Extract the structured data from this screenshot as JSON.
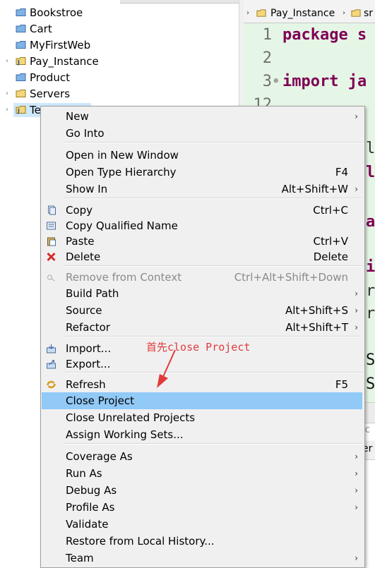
{
  "explorer": {
    "items": [
      {
        "label": "Bookstroe",
        "icon": "project-folder-icon",
        "expandable": false
      },
      {
        "label": "Cart",
        "icon": "project-folder-icon",
        "expandable": false
      },
      {
        "label": "MyFirstWeb",
        "icon": "project-folder-icon",
        "expandable": false
      },
      {
        "label": "Pay_Instance",
        "icon": "java-project-icon",
        "expandable": true
      },
      {
        "label": "Product",
        "icon": "project-folder-icon",
        "expandable": false
      },
      {
        "label": "Servers",
        "icon": "folder-icon",
        "expandable": true
      },
      {
        "label": "Te",
        "icon": "open-project-icon",
        "expandable": true,
        "selected": true
      }
    ],
    "arrow_glyph": "›"
  },
  "editor": {
    "tab_label": "Pay_Instance",
    "tab2_label": "sr",
    "lines": [
      {
        "num": "1",
        "text": "package s"
      },
      {
        "num": "2",
        "text": ""
      },
      {
        "num": "3",
        "text": "import ja"
      },
      {
        "num": "12",
        "text": ""
      }
    ],
    "fragments": [
      "l",
      "l",
      "a",
      "i",
      "r",
      "r",
      "S",
      "S",
      "c",
      "er"
    ]
  },
  "menu": {
    "items": [
      {
        "label": "New",
        "shortcut": "",
        "submenu": true
      },
      {
        "label": "Go Into",
        "shortcut": "",
        "submenu": false
      },
      {
        "label": "Open in New Window",
        "shortcut": "",
        "submenu": false
      },
      {
        "label": "Open Type Hierarchy",
        "shortcut": "F4",
        "submenu": false
      },
      {
        "label": "Show In",
        "shortcut": "Alt+Shift+W",
        "submenu": true
      },
      {
        "label": "Copy",
        "shortcut": "Ctrl+C",
        "submenu": false,
        "icon": "copy-icon"
      },
      {
        "label": "Copy Qualified Name",
        "shortcut": "",
        "submenu": false,
        "icon": "copy-qualified-icon"
      },
      {
        "label": "Paste",
        "shortcut": "Ctrl+V",
        "submenu": false,
        "icon": "paste-icon"
      },
      {
        "label": "Delete",
        "shortcut": "Delete",
        "submenu": false,
        "icon": "delete-icon"
      },
      {
        "label": "Remove from Context",
        "shortcut": "Ctrl+Alt+Shift+Down",
        "submenu": false,
        "disabled": true,
        "icon": "remove-context-icon"
      },
      {
        "label": "Build Path",
        "shortcut": "",
        "submenu": true
      },
      {
        "label": "Source",
        "shortcut": "Alt+Shift+S",
        "submenu": true
      },
      {
        "label": "Refactor",
        "shortcut": "Alt+Shift+T",
        "submenu": true
      },
      {
        "label": "Import...",
        "shortcut": "",
        "submenu": false,
        "icon": "import-icon"
      },
      {
        "label": "Export...",
        "shortcut": "",
        "submenu": false,
        "icon": "export-icon"
      },
      {
        "label": "Refresh",
        "shortcut": "F5",
        "submenu": false,
        "icon": "refresh-icon"
      },
      {
        "label": "Close Project",
        "shortcut": "",
        "submenu": false,
        "highlighted": true
      },
      {
        "label": "Close Unrelated Projects",
        "shortcut": "",
        "submenu": false
      },
      {
        "label": "Assign Working Sets...",
        "shortcut": "",
        "submenu": false
      },
      {
        "label": "Coverage As",
        "shortcut": "",
        "submenu": true
      },
      {
        "label": "Run As",
        "shortcut": "",
        "submenu": true
      },
      {
        "label": "Debug As",
        "shortcut": "",
        "submenu": true
      },
      {
        "label": "Profile As",
        "shortcut": "",
        "submenu": true
      },
      {
        "label": "Validate",
        "shortcut": "",
        "submenu": false
      },
      {
        "label": "Restore from Local History...",
        "shortcut": "",
        "submenu": false
      },
      {
        "label": "Team",
        "shortcut": "",
        "submenu": true
      }
    ],
    "submenu_glyph": "›"
  },
  "annotation": {
    "text": "首先close Project",
    "color": "#e23a3a"
  },
  "colors": {
    "highlight": "#91c9f7",
    "selection": "#cfe8fc",
    "code_bg": "#e6f6e6",
    "keyword": "#7f0055"
  }
}
